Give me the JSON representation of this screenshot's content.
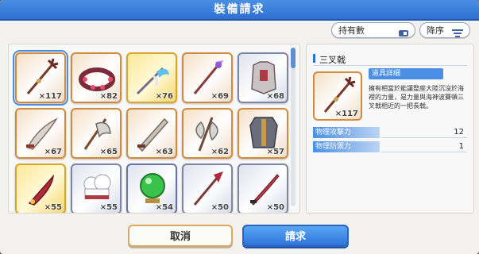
{
  "dialog": {
    "title": "裝備請求",
    "sort_field_label": "持有數",
    "sort_order_label": "降序",
    "cancel_label": "取消",
    "confirm_label": "請求"
  },
  "items": [
    {
      "name": "trident",
      "count": "×117",
      "frame": "bronze",
      "selected": true
    },
    {
      "name": "beaded-bracelet",
      "count": "×82",
      "frame": "bronze"
    },
    {
      "name": "feathered-staff",
      "count": "×76",
      "frame": "gold"
    },
    {
      "name": "crystal-scepter",
      "count": "×69",
      "frame": "bronze"
    },
    {
      "name": "armor",
      "count": "×68",
      "frame": "silver"
    },
    {
      "name": "curved-sword",
      "count": "×67",
      "frame": "bronze"
    },
    {
      "name": "battle-axe",
      "count": "×65",
      "frame": "bronze"
    },
    {
      "name": "serrated-sword",
      "count": "×63",
      "frame": "bronze"
    },
    {
      "name": "great-axe",
      "count": "×62",
      "frame": "bronze"
    },
    {
      "name": "robe",
      "count": "×57",
      "frame": "bronze"
    },
    {
      "name": "ornate-blade",
      "count": "×55",
      "frame": "gold"
    },
    {
      "name": "chef-hat",
      "count": "×55",
      "frame": "silver"
    },
    {
      "name": "green-orb",
      "count": "×54",
      "frame": "green"
    },
    {
      "name": "glaive",
      "count": "×50",
      "frame": "silver"
    },
    {
      "name": "katana",
      "count": "×50",
      "frame": "silver"
    }
  ],
  "detail": {
    "name": "三叉戟",
    "section_label": "道具詳細",
    "count": "×117",
    "description": "擁有相當於能讓整座大陸沉沒於海裡的力量，是力量與海神波賽頓三叉戟相近的一把長戟。",
    "stats": [
      {
        "label": "物理攻擊力",
        "value": "12"
      },
      {
        "label": "物理防禦力",
        "value": "1"
      }
    ]
  },
  "colors": {
    "accent": "#2f6fd0",
    "bronze_frame": "#d28a3e",
    "gold_frame": "#d9a52a",
    "silver_frame": "#7d86a3"
  }
}
